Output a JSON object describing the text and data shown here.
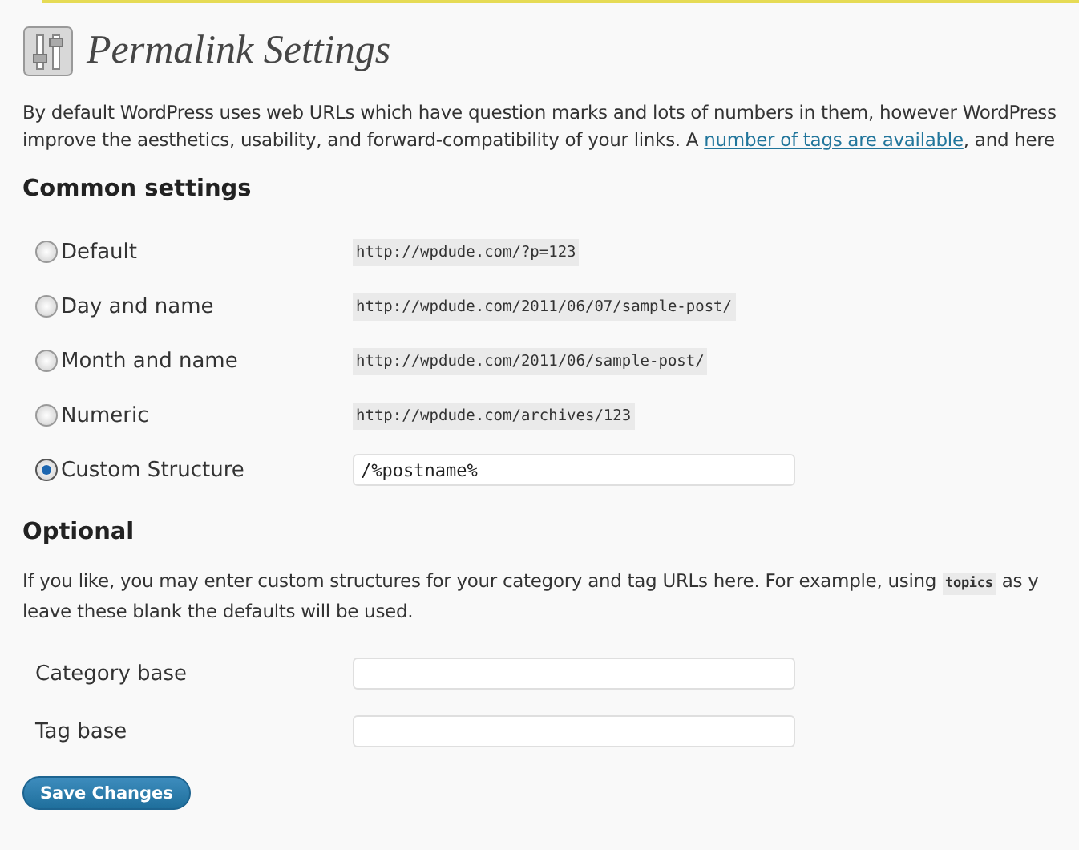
{
  "page_title": "Permalink Settings",
  "intro": {
    "line1": "By default WordPress uses web URLs which have question marks and lots of numbers in them, however WordPress",
    "line2_before": "improve the aesthetics, usability, and forward-compatibility of your links. A ",
    "link": "number of tags are available",
    "line2_after": ", and here"
  },
  "common_heading": "Common settings",
  "options": [
    {
      "label": "Default",
      "kind": "example",
      "example": "http://wpdude.com/?p=123",
      "selected": false
    },
    {
      "label": "Day and name",
      "kind": "example",
      "example": "http://wpdude.com/2011/06/07/sample-post/",
      "selected": false
    },
    {
      "label": "Month and name",
      "kind": "example",
      "example": "http://wpdude.com/2011/06/sample-post/",
      "selected": false
    },
    {
      "label": "Numeric",
      "kind": "example",
      "example": "http://wpdude.com/archives/123",
      "selected": false
    },
    {
      "label": "Custom Structure",
      "kind": "input",
      "value": "/%postname%",
      "selected": true
    }
  ],
  "optional_heading": "Optional",
  "optional_text": {
    "before": "If you like, you may enter custom structures for your category and tag URLs here. For example, using ",
    "code": "topics",
    "after": " as y",
    "line2": "leave these blank the defaults will be used."
  },
  "bases": [
    {
      "label": "Category base"
    },
    {
      "label": "Tag base"
    }
  ],
  "save_button": "Save Changes"
}
